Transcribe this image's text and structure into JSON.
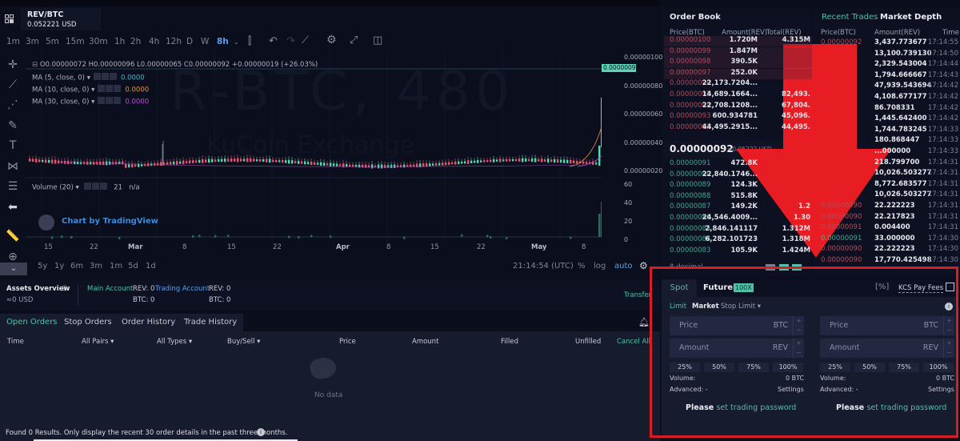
{
  "header": {
    "pair": "REV/BTC",
    "usd_price": "0.052221 USD"
  },
  "timeframes": [
    "1m",
    "3m",
    "5m",
    "15m",
    "30m",
    "1h",
    "2h",
    "4h",
    "12h",
    "D",
    "W",
    "8h"
  ],
  "active_timeframe": "8h",
  "chart": {
    "watermark": "R-BTC, 480",
    "watermark_sub": "KuCoin Exchange",
    "ohlc": "O0.00000072  H0.00000096  L0.00000065  C0.00000092   +0.00000019 (+26.03%)",
    "indicators": [
      {
        "label": "MA (5, close, 0)",
        "value": "0.0000",
        "color": "#3fb8d2"
      },
      {
        "label": "MA (10, close, 0)",
        "value": "0.0000",
        "color": "#e8923c"
      },
      {
        "label": "MA (30, close, 0)",
        "value": "0.0000",
        "color": "#c048d8"
      }
    ],
    "volume_label": "Volume (20)",
    "volume_value": "21",
    "volume_na": "n/a",
    "y_ticks": [
      "0.00000100",
      "0.00000080",
      "0.00000060",
      "0.00000040",
      "0.00000020"
    ],
    "price_tag": "0.00000092",
    "vol_ticks": [
      "60",
      "40",
      "20",
      "0"
    ],
    "x_ticks": [
      {
        "t": "15"
      },
      {
        "t": "22"
      },
      {
        "t": "Mar",
        "b": true
      },
      {
        "t": "8"
      },
      {
        "t": "15"
      },
      {
        "t": "22"
      },
      {
        "t": "Apr",
        "b": true
      },
      {
        "t": "8"
      },
      {
        "t": "15"
      },
      {
        "t": "22"
      },
      {
        "t": "May",
        "b": true
      },
      {
        "t": "8"
      }
    ],
    "ranges": [
      "5y",
      "1y",
      "6m",
      "3m",
      "1m",
      "5d",
      "1d"
    ],
    "time": "21:14:54 (UTC)",
    "pct": "%",
    "log": "log",
    "auto": "auto",
    "tv_text": "Chart by TradingView"
  },
  "orderbook": {
    "title": "Order Book",
    "headers": [
      "Price(BTC)",
      "Amount(REV)",
      "Total(REV)"
    ],
    "asks": [
      {
        "p": "0.00000100",
        "a": "1.720M",
        "t": "4.315M"
      },
      {
        "p": "0.00000099",
        "a": "1.847M",
        "t": ""
      },
      {
        "p": "0.00000098",
        "a": "390.5K",
        "t": ""
      },
      {
        "p": "0.00000097",
        "a": "252.0K",
        "t": ""
      },
      {
        "p": "0.00000096",
        "a": "22,173.7204...",
        "t": ""
      },
      {
        "p": "0.00000095",
        "a": "14,689.1664...",
        "t": "82,493."
      },
      {
        "p": "0.00000094",
        "a": "22,708.1208...",
        "t": "67,804."
      },
      {
        "p": "0.00000093",
        "a": "600.934781",
        "t": "45,096."
      },
      {
        "p": "0.00000092",
        "a": "44,495.2915...",
        "t": "44,495."
      }
    ],
    "mid_price": "0.00000092",
    "mid_usd": "≈0.05222 USD",
    "bids": [
      {
        "p": "0.00000091",
        "a": "472.8K",
        "t": ""
      },
      {
        "p": "0.00000090",
        "a": "22,840.1746...",
        "t": ""
      },
      {
        "p": "0.00000089",
        "a": "124.3K",
        "t": ""
      },
      {
        "p": "0.00000088",
        "a": "515.8K",
        "t": ""
      },
      {
        "p": "0.00000087",
        "a": "149.2K",
        "t": "1.2"
      },
      {
        "p": "0.00000086",
        "a": "24,546.4009...",
        "t": "1.30"
      },
      {
        "p": "0.00000085",
        "a": "2,846.141117",
        "t": "1.312M"
      },
      {
        "p": "0.00000084",
        "a": "6,282.101723",
        "t": "1.318M"
      },
      {
        "p": "0.00000083",
        "a": "105.9K",
        "t": "1.424M"
      }
    ],
    "decimal": "8 decimal"
  },
  "trades": {
    "tabs": [
      "Recent Trades",
      "Market Depth"
    ],
    "headers": [
      "Price(BTC)",
      "Amount(REV)",
      "Time"
    ],
    "rows": [
      {
        "p": "0.00000092",
        "a": "3,437.773677",
        "t": "17:14:55"
      },
      {
        "p": "",
        "a": "13,100.739130",
        "t": "17:14:50"
      },
      {
        "p": "",
        "a": "2,329.543004",
        "t": "17:14:44"
      },
      {
        "p": "",
        "a": "1,794.666667",
        "t": "17:14:43"
      },
      {
        "p": "",
        "a": "47,939.543694",
        "t": "17:14:42"
      },
      {
        "p": "",
        "a": "4,108.677177",
        "t": "17:14:42"
      },
      {
        "p": "",
        "a": "86.708331",
        "t": "17:14:42"
      },
      {
        "p": "",
        "a": "1,445.642400",
        "t": "17:14:42"
      },
      {
        "p": "",
        "a": "1,744.783245",
        "t": "17:14:33"
      },
      {
        "p": "",
        "a": "180.868447",
        "t": "17:14:33"
      },
      {
        "p": "",
        "a": "...000000",
        "t": "17:14:33"
      },
      {
        "p": "",
        "a": "218.799700",
        "t": "17:14:31"
      },
      {
        "p": "",
        "a": "10,026.503277",
        "t": "17:14:31"
      },
      {
        "p": "",
        "a": "8,772.683577",
        "t": "17:14:31"
      },
      {
        "p": "",
        "a": "10,026.503277",
        "t": "17:14:31"
      },
      {
        "p": "0.00000090",
        "a": "22.222223",
        "t": "17:14:31"
      },
      {
        "p": "0.00000090",
        "a": "22.217823",
        "t": "17:14:31"
      },
      {
        "p": "0.00000091",
        "a": "0.004400",
        "t": "17:14:31"
      },
      {
        "p": "0.00000091",
        "a": "33.000000",
        "t": "17:14:30",
        "buy": true
      },
      {
        "p": "0.00000090",
        "a": "22.222223",
        "t": "17:14:30"
      },
      {
        "p": "0.00000090",
        "a": "17,770.425498",
        "t": "17:14:30"
      }
    ]
  },
  "assets": {
    "title": "Assets Overview",
    "usd": "≈0 USD",
    "main": "Main Account",
    "trading": "Trading Account",
    "main_rev": "REV: 0",
    "main_btc": "BTC: 0",
    "trade_rev": "REV: 0",
    "trade_btc": "BTC: 0",
    "transfer": "Transfer"
  },
  "orders": {
    "tabs": [
      "Open Orders",
      "Stop Orders",
      "Order History",
      "Trade History"
    ],
    "columns": [
      "Time",
      "All Pairs",
      "All Types",
      "Buy/Sell",
      "Price",
      "Amount",
      "Filled",
      "Unfilled",
      "Cancel All"
    ],
    "empty": "No data",
    "footer": "Found 0 Results. Only display the recent 30 order details in the past three months."
  },
  "trade": {
    "spot": "Spot",
    "futures": "Futures",
    "leverage": "100X",
    "kcs": "KCS Pay Fees",
    "types": [
      "Limit",
      "Market",
      "Stop Limit"
    ],
    "price": "Price",
    "amount": "Amount",
    "btc": "BTC",
    "rev": "REV",
    "pcts": [
      "25%",
      "50%",
      "75%",
      "100%"
    ],
    "volume": "Volume:",
    "volume_val": "0 BTC",
    "advanced": "Advanced: -",
    "settings": "Settings",
    "please": "Please",
    "set_pw": "set trading password"
  }
}
